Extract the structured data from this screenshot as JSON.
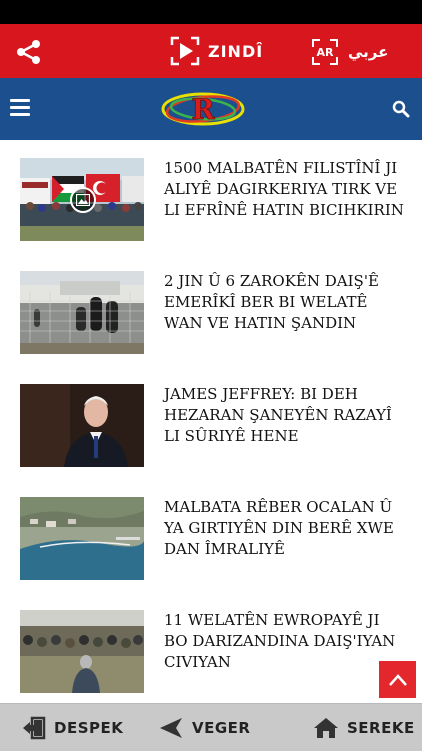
{
  "top_bar": {
    "live_label": "ZINDÎ",
    "lang_code": "AR",
    "lang_name": "عربي",
    "share_icon": "share-icon",
    "live_icon": "play-icon",
    "background": "#d7161e"
  },
  "nav_bar": {
    "menu_icon": "hamburger-menu-icon",
    "logo": "rudaw-logo",
    "search_icon": "search-icon",
    "background": "#1b4f8e"
  },
  "articles": [
    {
      "headline": "1500 MALBATÊN FILISTÎNÎ JI ALIYÊ DAGIRKERIYA TIRK VE LI EFRÎNÊ HATIN BICIHKIRIN",
      "thumb": "crowd-flags-photo",
      "has_gallery_badge": true
    },
    {
      "headline": "2 JIN Û 6 ZAROKÊN DAIŞ'Ê EMERÎKÎ BER BI WELATÊ WAN VE HATIN ŞANDIN",
      "thumb": "camp-fence-photo",
      "has_gallery_badge": false
    },
    {
      "headline": "JAMES JEFFREY: BI DEH HEZARAN ŞANEYÊN RAZAYÎ LI SÛRIYÊ HENE",
      "thumb": "portrait-photo",
      "has_gallery_badge": false
    },
    {
      "headline": "MALBATA RÊBER OCALAN Û YA GIRTIYÊN DIN BERÊ XWE DAN ÎMRALIYÊ",
      "thumb": "island-aerial-photo",
      "has_gallery_badge": false
    },
    {
      "headline": "11 WELATÊN EWROPAYÊ JI BO DARIZANDINA DAIŞ'IYAN CIVIYAN",
      "thumb": "seated-crowd-photo",
      "has_gallery_badge": false
    }
  ],
  "scroll_top_icon": "chevron-up-icon",
  "bottom_bar": {
    "despek_label": "DESPEK",
    "veger_label": "VEGER",
    "sereke_label": "SEREKE",
    "despek_icon": "exit-icon",
    "veger_icon": "back-arrow-icon",
    "sereke_icon": "home-icon"
  }
}
